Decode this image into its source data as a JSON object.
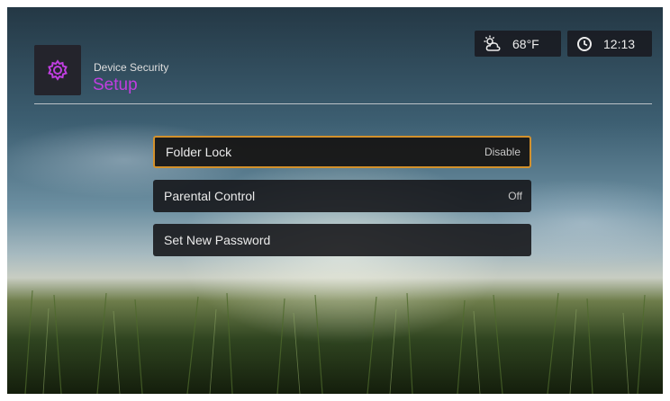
{
  "header": {
    "subtitle": "Device Security",
    "title": "Setup",
    "icon": "gear-icon",
    "accent_color": "#c03ee0"
  },
  "status": {
    "weather_icon": "partly-cloudy-icon",
    "temperature": "68°F",
    "clock_icon": "clock-icon",
    "time": "12:13"
  },
  "menu": {
    "selection_color": "#d3912c",
    "items": [
      {
        "label": "Folder Lock",
        "value": "Disable",
        "selected": true
      },
      {
        "label": "Parental Control",
        "value": "Off",
        "selected": false
      },
      {
        "label": "Set New Password",
        "value": "",
        "selected": false
      }
    ]
  }
}
